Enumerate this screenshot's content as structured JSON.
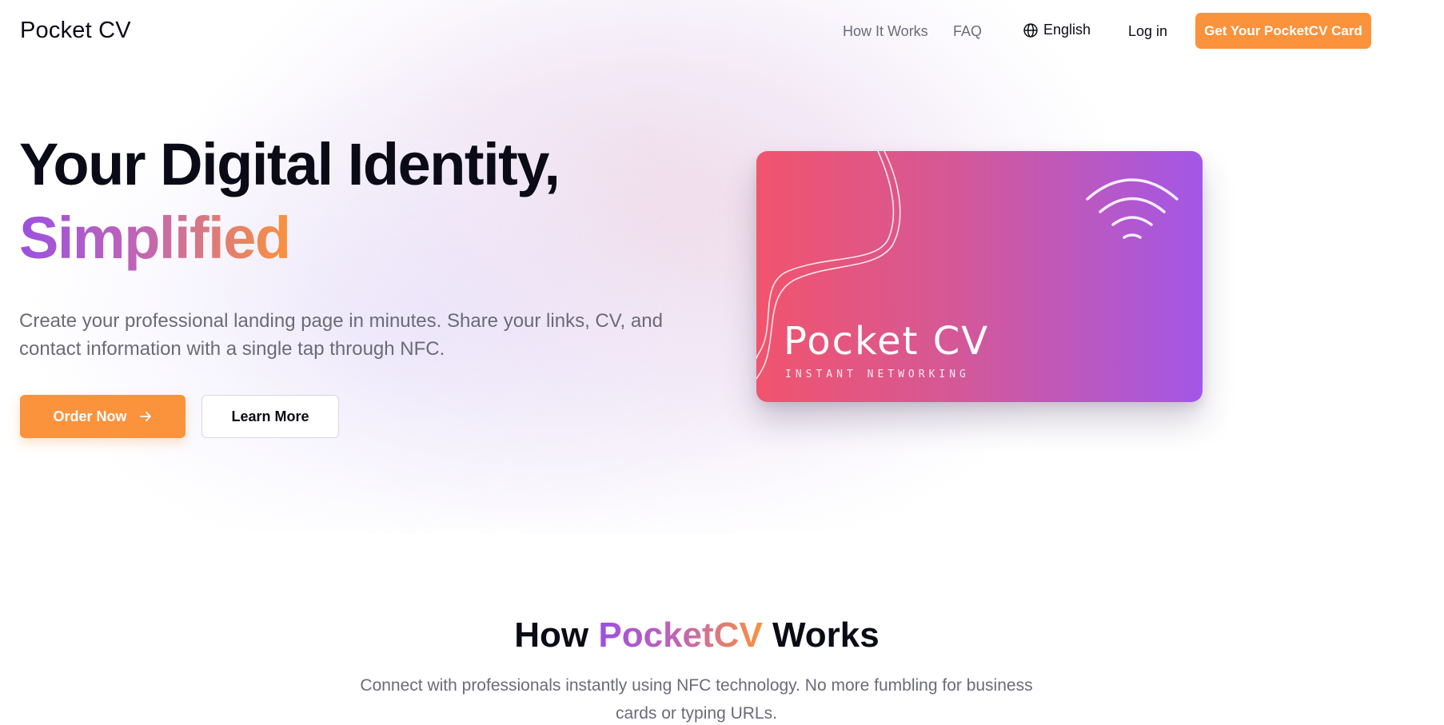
{
  "header": {
    "brand": "Pocket CV",
    "nav": {
      "how_it_works": "How It Works",
      "faq": "FAQ",
      "language": "English",
      "login": "Log in",
      "cta": "Get Your PocketCV Card"
    }
  },
  "hero": {
    "headline_line1": "Your Digital Identity,",
    "headline_line2": "Simplified",
    "description": "Create your professional landing page in minutes. Share your links, CV, and contact information with a single tap through NFC.",
    "order_button": "Order Now",
    "learn_button": "Learn More"
  },
  "card": {
    "title": "Pocket CV",
    "tagline": "INSTANT NETWORKING",
    "icon": "nfc-waves-icon"
  },
  "how_section": {
    "title_prefix": "How ",
    "title_accent": "PocketCV",
    "title_suffix": " Works",
    "description": "Connect with professionals instantly using NFC technology. No more fumbling for business cards or typing URLs."
  },
  "colors": {
    "accent_orange": "#fb923c",
    "accent_purple": "#9b51e0",
    "card_gradient_start": "#f1546d",
    "card_gradient_end": "#a357e7",
    "text_muted": "#6b6b78"
  }
}
